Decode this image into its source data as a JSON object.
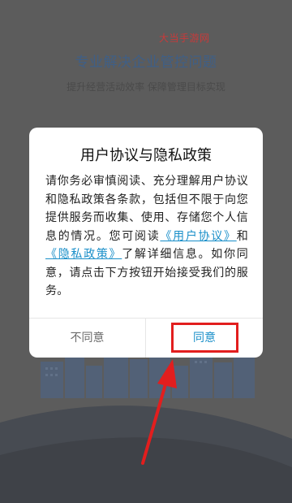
{
  "watermark": "大当手游网",
  "background": {
    "title": "专业解决企业管控问题",
    "subtitle": "提升经营活动效率 保障管理目标实现"
  },
  "dialog": {
    "title": "用户协议与隐私政策",
    "body_part1": "请你务必审慎阅读、充分理解用户协议和隐私政策各条款，包括但不限于向您提供服务而收集、使用、存储您个人信息的情况。您可阅读",
    "link_user_agreement": "《用户协议》",
    "body_and": "和",
    "link_privacy_policy": "《隐私政策》",
    "body_part2": "了解详细信息。如你同意，请点击下方按钮开始接受我们的服务。",
    "disagree_label": "不同意",
    "agree_label": "同意"
  },
  "colors": {
    "accent": "#1a8fc9",
    "annotation_red": "#e21e1e"
  }
}
